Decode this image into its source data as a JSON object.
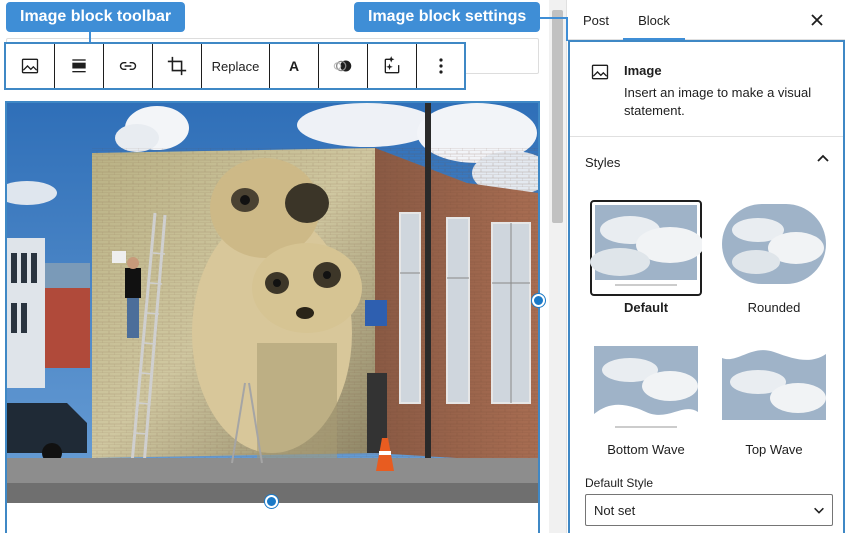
{
  "annotations": {
    "toolbar_label": "Image block toolbar",
    "settings_label": "Image block settings"
  },
  "toolbar": {
    "buttons": [
      {
        "name": "image-icon"
      },
      {
        "name": "align-icon"
      },
      {
        "name": "link-icon"
      },
      {
        "name": "crop-icon"
      },
      {
        "name": "replace",
        "label": "Replace"
      },
      {
        "name": "text-overlay-icon",
        "label": "A"
      },
      {
        "name": "duotone-icon"
      },
      {
        "name": "ai-sparkle-icon"
      },
      {
        "name": "more-options-icon"
      }
    ]
  },
  "sidebar": {
    "tabs": [
      {
        "label": "Post",
        "active": false
      },
      {
        "label": "Block",
        "active": true
      }
    ],
    "close_icon": "close-icon",
    "block": {
      "title": "Image",
      "description": "Insert an image to make a visual statement."
    },
    "styles": {
      "title": "Styles",
      "expanded": true,
      "options": [
        {
          "label": "Default",
          "selected": true
        },
        {
          "label": "Rounded",
          "selected": false
        },
        {
          "label": "Bottom Wave",
          "selected": false
        },
        {
          "label": "Top Wave",
          "selected": false
        }
      ]
    },
    "default_style": {
      "label": "Default Style",
      "value": "Not set"
    }
  },
  "colors": {
    "accent": "#3f88c5",
    "callout": "#3f8ed6",
    "handle": "#1a79c7"
  }
}
